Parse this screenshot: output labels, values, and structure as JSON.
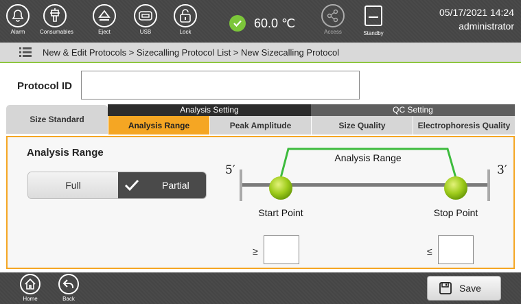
{
  "toolbar": {
    "buttons": [
      {
        "label": "Alarm",
        "icon": "alarm-bell-icon"
      },
      {
        "label": "Consumables",
        "icon": "consumables-icon"
      },
      {
        "label": "Eject",
        "icon": "eject-icon"
      },
      {
        "label": "USB",
        "icon": "usb-icon"
      },
      {
        "label": "Lock",
        "icon": "lock-icon"
      },
      {
        "label": "Access",
        "icon": "share-icon"
      },
      {
        "label": "Standby",
        "icon": "standby-icon"
      }
    ],
    "temperature": "60.0 ℃",
    "temperature_status_color": "#7cc63a",
    "datetime": "05/17/2021 14:24",
    "user": "administrator"
  },
  "breadcrumb": {
    "text": "New & Edit Protocols > Sizecalling Protocol List > New Sizecalling Protocol",
    "icon": "menu-list-icon"
  },
  "protocol": {
    "id_label": "Protocol ID",
    "id_value": ""
  },
  "tabs": {
    "size_standard": "Size Standard",
    "analysis_group": "Analysis Setting",
    "qc_group": "QC Setting",
    "analysis_range": "Analysis Range",
    "peak_amplitude": "Peak Amplitude",
    "size_quality": "Size Quality",
    "electrophoresis_quality": "Electrophoresis Quality",
    "active": "Analysis Range",
    "active_color": "#f5a623"
  },
  "analysis_range": {
    "title": "Analysis Range",
    "options": [
      "Full",
      "Partial"
    ],
    "selected": "Partial",
    "diagram": {
      "five_prime": "5′",
      "three_prime": "3′",
      "range_label": "Analysis Range",
      "start_label": "Start Point",
      "stop_label": "Stop Point",
      "range_color": "#3dbb3d"
    },
    "start_symbol": "≥",
    "stop_symbol": "≤",
    "start_value": "",
    "stop_value": ""
  },
  "bottom": {
    "home_label": "Home",
    "back_label": "Back",
    "save_label": "Save"
  }
}
